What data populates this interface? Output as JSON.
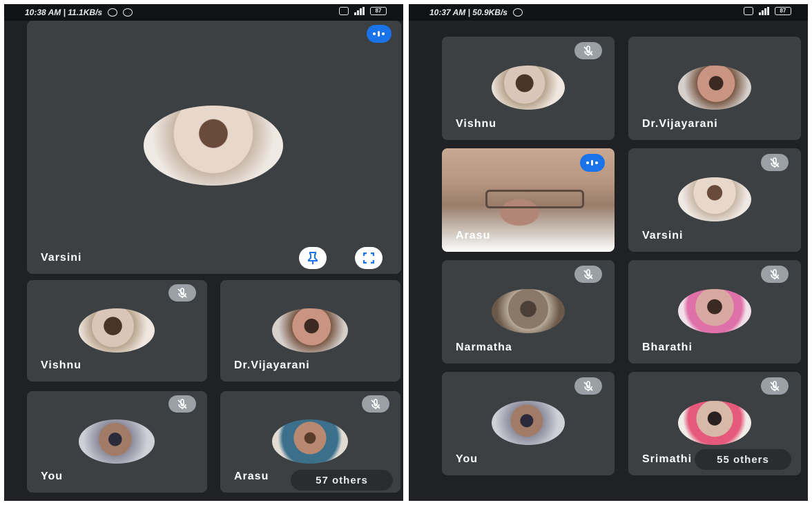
{
  "left_phone": {
    "status": {
      "time": "10:38 AM | 11.1KB/s",
      "battery": "87"
    },
    "featured": {
      "name": "Varsini"
    },
    "tiles": [
      {
        "name": "Vishnu"
      },
      {
        "name": "Dr.Vijayarani"
      },
      {
        "name": "You"
      },
      {
        "name": "Arasu"
      }
    ],
    "others_label": "57 others"
  },
  "right_phone": {
    "status": {
      "time": "10:37 AM | 50.9KB/s",
      "battery": "87"
    },
    "tiles": [
      {
        "name": "Vishnu"
      },
      {
        "name": "Dr.Vijayarani"
      },
      {
        "name": "Arasu"
      },
      {
        "name": "Varsini"
      },
      {
        "name": "Narmatha"
      },
      {
        "name": "Bharathi"
      },
      {
        "name": "You"
      },
      {
        "name": "Srimathi"
      }
    ],
    "others_label": "55 others"
  },
  "colors": {
    "accent": "#1a73e8",
    "tile": "#3c4043",
    "background": "#202124"
  }
}
